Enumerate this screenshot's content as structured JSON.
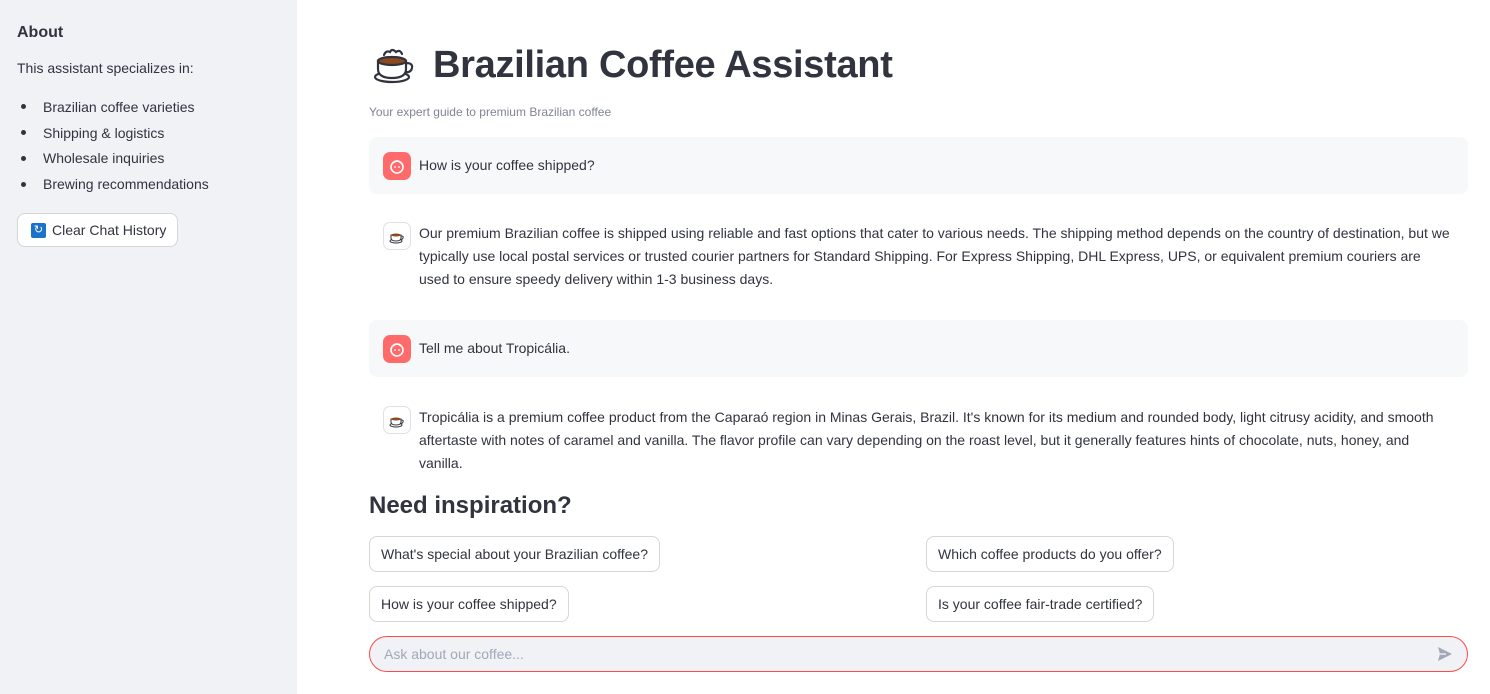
{
  "sidebar": {
    "heading": "About",
    "intro": "This assistant specializes in:",
    "items": [
      "Brazilian coffee varieties",
      "Shipping & logistics",
      "Wholesale inquiries",
      "Brewing recommendations"
    ],
    "clear_button": "Clear Chat History",
    "clear_icon": "refresh-icon"
  },
  "header": {
    "icon": "coffee-cup-icon",
    "title": "Brazilian Coffee Assistant",
    "caption": "Your expert guide to premium Brazilian coffee"
  },
  "messages": [
    {
      "role": "user",
      "text": "How is your coffee shipped?"
    },
    {
      "role": "assistant",
      "text": "Our premium Brazilian coffee is shipped using reliable and fast options that cater to various needs. The shipping method depends on the country of destination, but we typically use local postal services or trusted courier partners for Standard Shipping. For Express Shipping, DHL Express, UPS, or equivalent premium couriers are used to ensure speedy delivery within 1-3 business days."
    },
    {
      "role": "user",
      "text": "Tell me about Tropicália."
    },
    {
      "role": "assistant",
      "text": "Tropicália is a premium coffee product from the Caparaó region in Minas Gerais, Brazil. It's known for its medium and rounded body, light citrusy acidity, and smooth aftertaste with notes of caramel and vanilla. The flavor profile can vary depending on the roast level, but it generally features hints of chocolate, nuts, honey, and vanilla."
    }
  ],
  "inspiration": {
    "heading": "Need inspiration?",
    "suggestions": [
      "What's special about your Brazilian coffee?",
      "Which coffee products do you offer?",
      "How is your coffee shipped?",
      "Is your coffee fair-trade certified?"
    ]
  },
  "chat_input": {
    "placeholder": "Ask about our coffee...",
    "value": ""
  },
  "colors": {
    "sidebar_bg": "#f0f2f6",
    "accent": "#ff4b4b",
    "user_avatar": "#ff6b6b"
  }
}
